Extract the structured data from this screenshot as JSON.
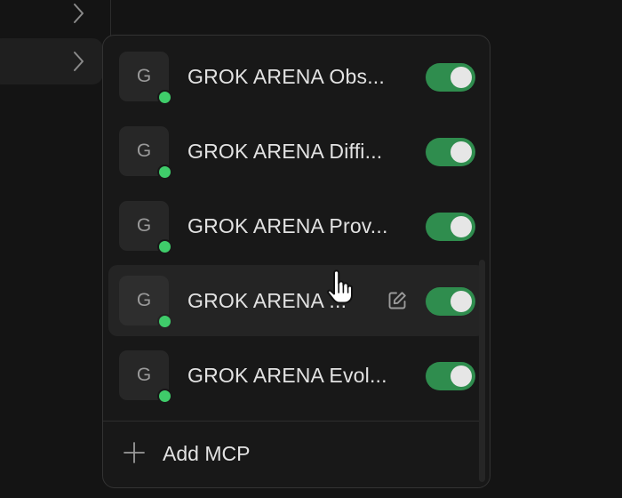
{
  "sidebar": {
    "chevron_icon": "chevron-right-icon"
  },
  "mcp_servers": [
    {
      "avatar_letter": "G",
      "name": "GROK ARENA Obs...",
      "status": "online",
      "enabled": true
    },
    {
      "avatar_letter": "G",
      "name": "GROK ARENA Diffi...",
      "status": "online",
      "enabled": true
    },
    {
      "avatar_letter": "G",
      "name": "GROK ARENA Prov...",
      "status": "online",
      "enabled": true
    },
    {
      "avatar_letter": "G",
      "name": "GROK ARENA ...",
      "status": "online",
      "enabled": true,
      "hovered": true,
      "edit_icon": "edit-icon"
    },
    {
      "avatar_letter": "G",
      "name": "GROK ARENA Evol...",
      "status": "online",
      "enabled": true
    }
  ],
  "footer": {
    "add_label": "Add MCP",
    "add_icon": "plus-icon"
  },
  "colors": {
    "toggle_on": "#2f8d4e",
    "status_online": "#3fcc6a",
    "popover_bg": "#181818",
    "hover_row_bg": "#242424"
  }
}
